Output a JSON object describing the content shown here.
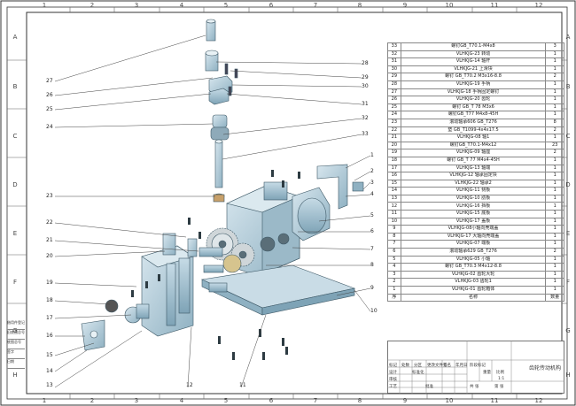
{
  "border_zones": {
    "top": [
      "1",
      "2",
      "3",
      "4",
      "5",
      "6",
      "7",
      "8",
      "9",
      "10",
      "11",
      "12"
    ],
    "bottom": [
      "1",
      "2",
      "3",
      "4",
      "5",
      "6",
      "7",
      "8",
      "9",
      "10",
      "11",
      "12"
    ],
    "sides": [
      "A",
      "B",
      "C",
      "D",
      "E",
      "F",
      "G",
      "H"
    ]
  },
  "callouts": [
    "1",
    "2",
    "3",
    "4",
    "5",
    "6",
    "7",
    "8",
    "9",
    "10",
    "11",
    "12",
    "13",
    "14",
    "15",
    "16",
    "17",
    "18",
    "19",
    "20",
    "21",
    "22",
    "23",
    "24",
    "25",
    "26",
    "27",
    "28",
    "29",
    "30",
    "31",
    "32",
    "33"
  ],
  "bom": {
    "rows": [
      {
        "no": "33",
        "name": "螺钉GB_T70.1-M4x8",
        "qty": "3"
      },
      {
        "no": "32",
        "name": "VLHKJG-23 转动",
        "qty": "1"
      },
      {
        "no": "31",
        "name": "VLHKJG-14 轴杆",
        "qty": "1"
      },
      {
        "no": "30",
        "name": "VLHKJG-21 上滑块",
        "qty": "1"
      },
      {
        "no": "29",
        "name": "螺钉 GB_T70.2 M3x16-8.8",
        "qty": "2"
      },
      {
        "no": "28",
        "name": "VLHKJG-19 手柄",
        "qty": "1"
      },
      {
        "no": "27",
        "name": "VLHKJG-18 手柄固定螺钉",
        "qty": "1"
      },
      {
        "no": "26",
        "name": "VLHKJG-20 齿轮",
        "qty": "1"
      },
      {
        "no": "25",
        "name": "螺钉 GB_T 78 M3x6",
        "qty": "1"
      },
      {
        "no": "24",
        "name": "螺钉GB_T77 M4x8-45H",
        "qty": "1"
      },
      {
        "no": "23",
        "name": "滚动轴承606 GB_T276",
        "qty": "8"
      },
      {
        "no": "22",
        "name": "垫 GB_T1099-4x4x17.5",
        "qty": "2"
      },
      {
        "no": "21",
        "name": "VLHKJG-08 轴1",
        "qty": "1"
      },
      {
        "no": "20",
        "name": "螺钉GB_T70.1-M4x12",
        "qty": "23"
      },
      {
        "no": "19",
        "name": "VLHKJG-09 轴座",
        "qty": "2"
      },
      {
        "no": "18",
        "name": "螺钉 GB_T 77 M4x4-45H",
        "qty": "1"
      },
      {
        "no": "17",
        "name": "VLHKJG-13 轴端",
        "qty": "1"
      },
      {
        "no": "16",
        "name": "VLHKJG-12 轴承固定块",
        "qty": "1"
      },
      {
        "no": "15",
        "name": "VLHKJG-22 轴承2",
        "qty": "1"
      },
      {
        "no": "14",
        "name": "VLHKJG-11 侧板",
        "qty": "1"
      },
      {
        "no": "13",
        "name": "VLHKJG-10 肋板",
        "qty": "1"
      },
      {
        "no": "12",
        "name": "VLHKJG-16 挡板",
        "qty": "1"
      },
      {
        "no": "11",
        "name": "VLHKJG-15 底板",
        "qty": "1"
      },
      {
        "no": "10",
        "name": "VLHKJG-17 盖板",
        "qty": "1"
      },
      {
        "no": "9",
        "name": "VLHKJG-08小轴向壳端盖",
        "qty": "1"
      },
      {
        "no": "8",
        "name": "VLHKJG-17 大轴向壳端盖",
        "qty": "1"
      },
      {
        "no": "7",
        "name": "VLHKJG-07 端板",
        "qty": "1"
      },
      {
        "no": "6",
        "name": "滚动轴承629 GB_T276",
        "qty": "2"
      },
      {
        "no": "5",
        "name": "VLHKJG-05 小轴",
        "qty": "1"
      },
      {
        "no": "4",
        "name": "螺钉 GB_T70.3 M4x12-8.8",
        "qty": "1"
      },
      {
        "no": "3",
        "name": "VLHKJG-02 齿轮大轮",
        "qty": "1"
      },
      {
        "no": "2",
        "name": "VLHKJG-03 齿轮1",
        "qty": "1"
      },
      {
        "no": "1",
        "name": "VLHKJG-01 齿轮箱体",
        "qty": "1"
      }
    ],
    "header": {
      "no": "序",
      "name": "名称",
      "qty": "数量"
    }
  },
  "title_block": {
    "drawing_name": "齿轮传动机构",
    "labels": [
      "标记",
      "处数",
      "分区",
      "更改文件号",
      "签名",
      "年月日",
      "设计",
      "标准化",
      "审核",
      "工艺",
      "批准",
      "阶段标记",
      "重量",
      "比例",
      "共 张",
      "第 张"
    ],
    "scale": "1:1",
    "sheet": "1"
  },
  "left_block": [
    "借用件登记",
    "旧底图总号",
    "底图总号",
    "签字",
    "日期"
  ]
}
